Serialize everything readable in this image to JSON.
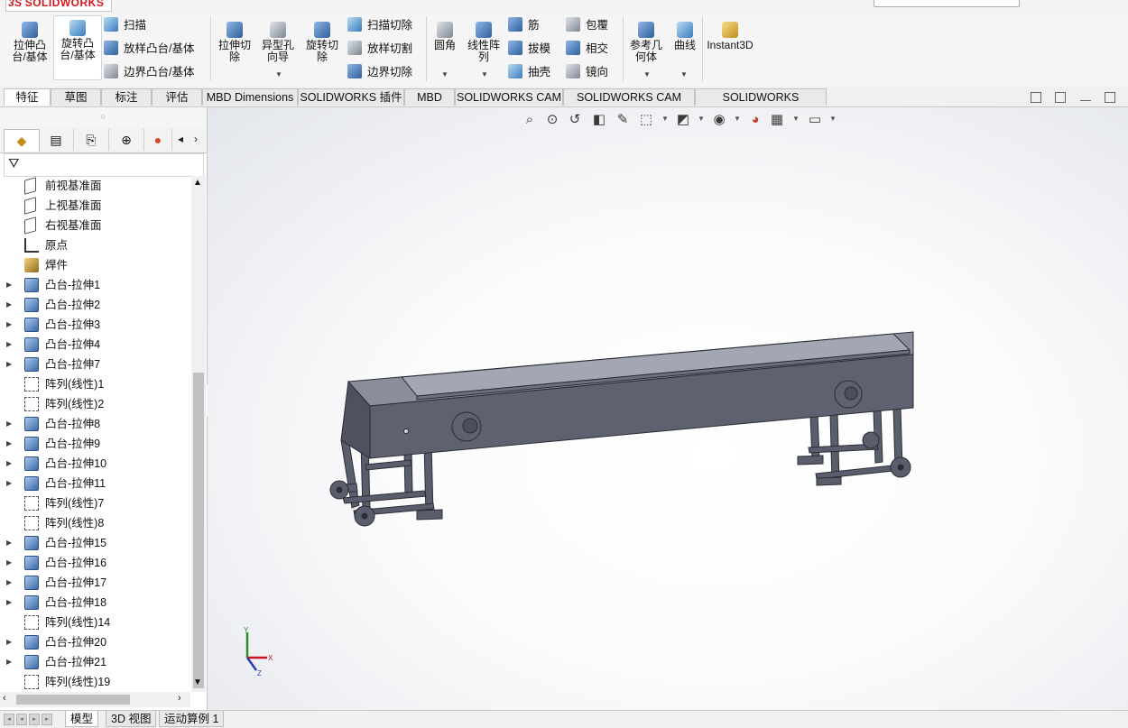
{
  "app": {
    "logo": "SOLIDWORKS",
    "logo_prefix": "3S"
  },
  "command_manager": {
    "big_buttons": [
      {
        "label1": "拉伸凸",
        "label2": "台/基体"
      },
      {
        "label1": "旋转凸",
        "label2": "台/基体"
      },
      {
        "label1": "拉伸切",
        "label2": "除"
      },
      {
        "label1": "异型孔",
        "label2": "向导"
      },
      {
        "label1": "旋转切",
        "label2": "除"
      },
      {
        "label1": "圆角",
        "label2": ""
      },
      {
        "label1": "线性阵",
        "label2": "列"
      },
      {
        "label1": "参考几",
        "label2": "何体"
      },
      {
        "label1": "曲线",
        "label2": ""
      },
      {
        "label1": "Instant3D",
        "label2": ""
      }
    ],
    "small_buttons": [
      {
        "label": "扫描"
      },
      {
        "label": "放样凸台/基体"
      },
      {
        "label": "边界凸台/基体"
      },
      {
        "label": "扫描切除"
      },
      {
        "label": "放样切割"
      },
      {
        "label": "边界切除"
      },
      {
        "label": "筋"
      },
      {
        "label": "拔模"
      },
      {
        "label": "抽壳"
      },
      {
        "label": "包覆"
      },
      {
        "label": "相交"
      },
      {
        "label": "镜向"
      }
    ]
  },
  "tabs": [
    {
      "label": "特征"
    },
    {
      "label": "草图"
    },
    {
      "label": "标注"
    },
    {
      "label": "评估"
    },
    {
      "label": "MBD Dimensions"
    },
    {
      "label": "SOLIDWORKS 插件"
    },
    {
      "label": "MBD"
    },
    {
      "label": "SOLIDWORKS CAM"
    },
    {
      "label": "SOLIDWORKS CAM TBM"
    },
    {
      "label": "SOLIDWORKS Inspection"
    }
  ],
  "feature_tree": {
    "items": [
      {
        "label": "前视基准面",
        "icon": "plane-icon",
        "expandable": false
      },
      {
        "label": "上视基准面",
        "icon": "plane-icon",
        "expandable": false
      },
      {
        "label": "右视基准面",
        "icon": "plane-icon",
        "expandable": false
      },
      {
        "label": "原点",
        "icon": "origin-icon",
        "expandable": false
      },
      {
        "label": "焊件",
        "icon": "weldment-icon",
        "expandable": false
      },
      {
        "label": "凸台-拉伸1",
        "icon": "boss-extrude-icon",
        "expandable": true
      },
      {
        "label": "凸台-拉伸2",
        "icon": "boss-extrude-icon",
        "expandable": true
      },
      {
        "label": "凸台-拉伸3",
        "icon": "boss-extrude-icon",
        "expandable": true
      },
      {
        "label": "凸台-拉伸4",
        "icon": "boss-extrude-icon",
        "expandable": true
      },
      {
        "label": "凸台-拉伸7",
        "icon": "boss-extrude-icon",
        "expandable": true
      },
      {
        "label": "阵列(线性)1",
        "icon": "linear-pattern-icon",
        "expandable": false
      },
      {
        "label": "阵列(线性)2",
        "icon": "linear-pattern-icon",
        "expandable": false
      },
      {
        "label": "凸台-拉伸8",
        "icon": "boss-extrude-icon",
        "expandable": true
      },
      {
        "label": "凸台-拉伸9",
        "icon": "boss-extrude-icon",
        "expandable": true
      },
      {
        "label": "凸台-拉伸10",
        "icon": "boss-extrude-icon",
        "expandable": true
      },
      {
        "label": "凸台-拉伸11",
        "icon": "boss-extrude-icon",
        "expandable": true
      },
      {
        "label": "阵列(线性)7",
        "icon": "linear-pattern-icon",
        "expandable": false
      },
      {
        "label": "阵列(线性)8",
        "icon": "linear-pattern-icon",
        "expandable": false
      },
      {
        "label": "凸台-拉伸15",
        "icon": "boss-extrude-icon",
        "expandable": true
      },
      {
        "label": "凸台-拉伸16",
        "icon": "boss-extrude-icon",
        "expandable": true
      },
      {
        "label": "凸台-拉伸17",
        "icon": "boss-extrude-icon",
        "expandable": true
      },
      {
        "label": "凸台-拉伸18",
        "icon": "boss-extrude-icon",
        "expandable": true
      },
      {
        "label": "阵列(线性)14",
        "icon": "linear-pattern-icon",
        "expandable": false
      },
      {
        "label": "凸台-拉伸20",
        "icon": "boss-extrude-icon",
        "expandable": true
      },
      {
        "label": "凸台-拉伸21",
        "icon": "boss-extrude-icon",
        "expandable": true
      },
      {
        "label": "阵列(线性)19",
        "icon": "linear-pattern-icon",
        "expandable": false
      }
    ]
  },
  "bottom_tabs": [
    {
      "label": "模型"
    },
    {
      "label": "3D 视图"
    },
    {
      "label": "运动算例 1"
    }
  ],
  "triad": {
    "x": "X",
    "y": "Y",
    "z": "Z"
  },
  "colors": {
    "model_face": "#5d6170",
    "model_top": "#8a8e9c",
    "accent": "#d6161c"
  }
}
